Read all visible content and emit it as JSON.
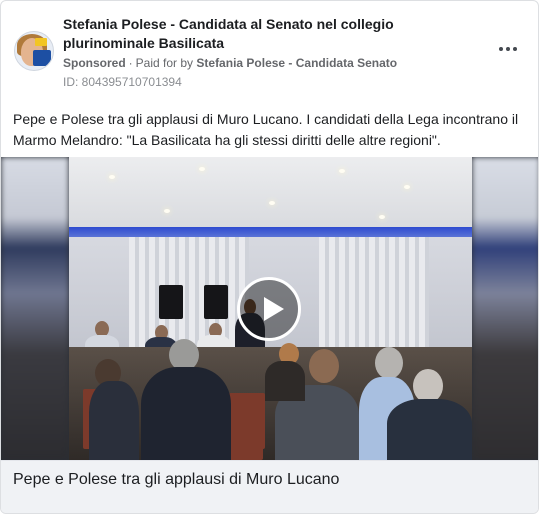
{
  "post": {
    "page_name": "Stefania Polese - Candidata al Senato nel collegio plurinominale Basilicata",
    "sponsored_label": "Sponsored",
    "separator": "·",
    "paid_for_prefix": "Paid for by",
    "paid_for_by": "Stefania Polese - Candidata Senato",
    "ad_id": "ID: 804395710701394",
    "more_icon": "more-horizontal-icon",
    "text": "Pepe e Polese tra gli applausi di Muro Lucano. I candidati della Lega incontrano il Marmo Melandro: \"La Basilicata ha gli stessi diritti delle altre regioni\".",
    "video": {
      "play_icon": "play-icon"
    },
    "caption": "Pepe e Polese tra gli applausi di Muro Lucano"
  },
  "colors": {
    "text_primary": "#1c1e21",
    "text_secondary": "#65676b",
    "caption_bg": "#f0f2f5",
    "border": "#dddfe2"
  }
}
